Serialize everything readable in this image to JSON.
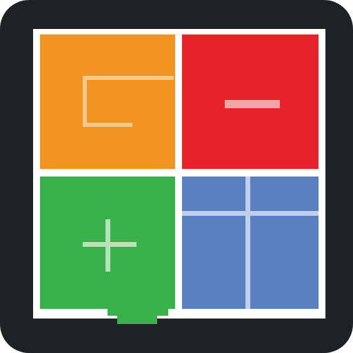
{
  "icon": {
    "name": "calculator-grid-app-icon",
    "colors": {
      "frame": "#1f2127",
      "border": "#ffffff",
      "orange": "#f39322",
      "red": "#e72329",
      "green": "#38b14b",
      "blue": "#5a80c2",
      "symbol_light": "#f6c88a",
      "minus_light": "#f7a4a6",
      "plus_light": "#b6e3b9",
      "grid_light": "#bfd0ee"
    },
    "tiles": [
      {
        "symbol_name": "bracket-symbol-icon",
        "color": "orange"
      },
      {
        "symbol_name": "minus-symbol-icon",
        "color": "red"
      },
      {
        "symbol_name": "plus-symbol-icon",
        "color": "green"
      },
      {
        "symbol_name": "grid-symbol-icon",
        "color": "blue"
      }
    ]
  }
}
